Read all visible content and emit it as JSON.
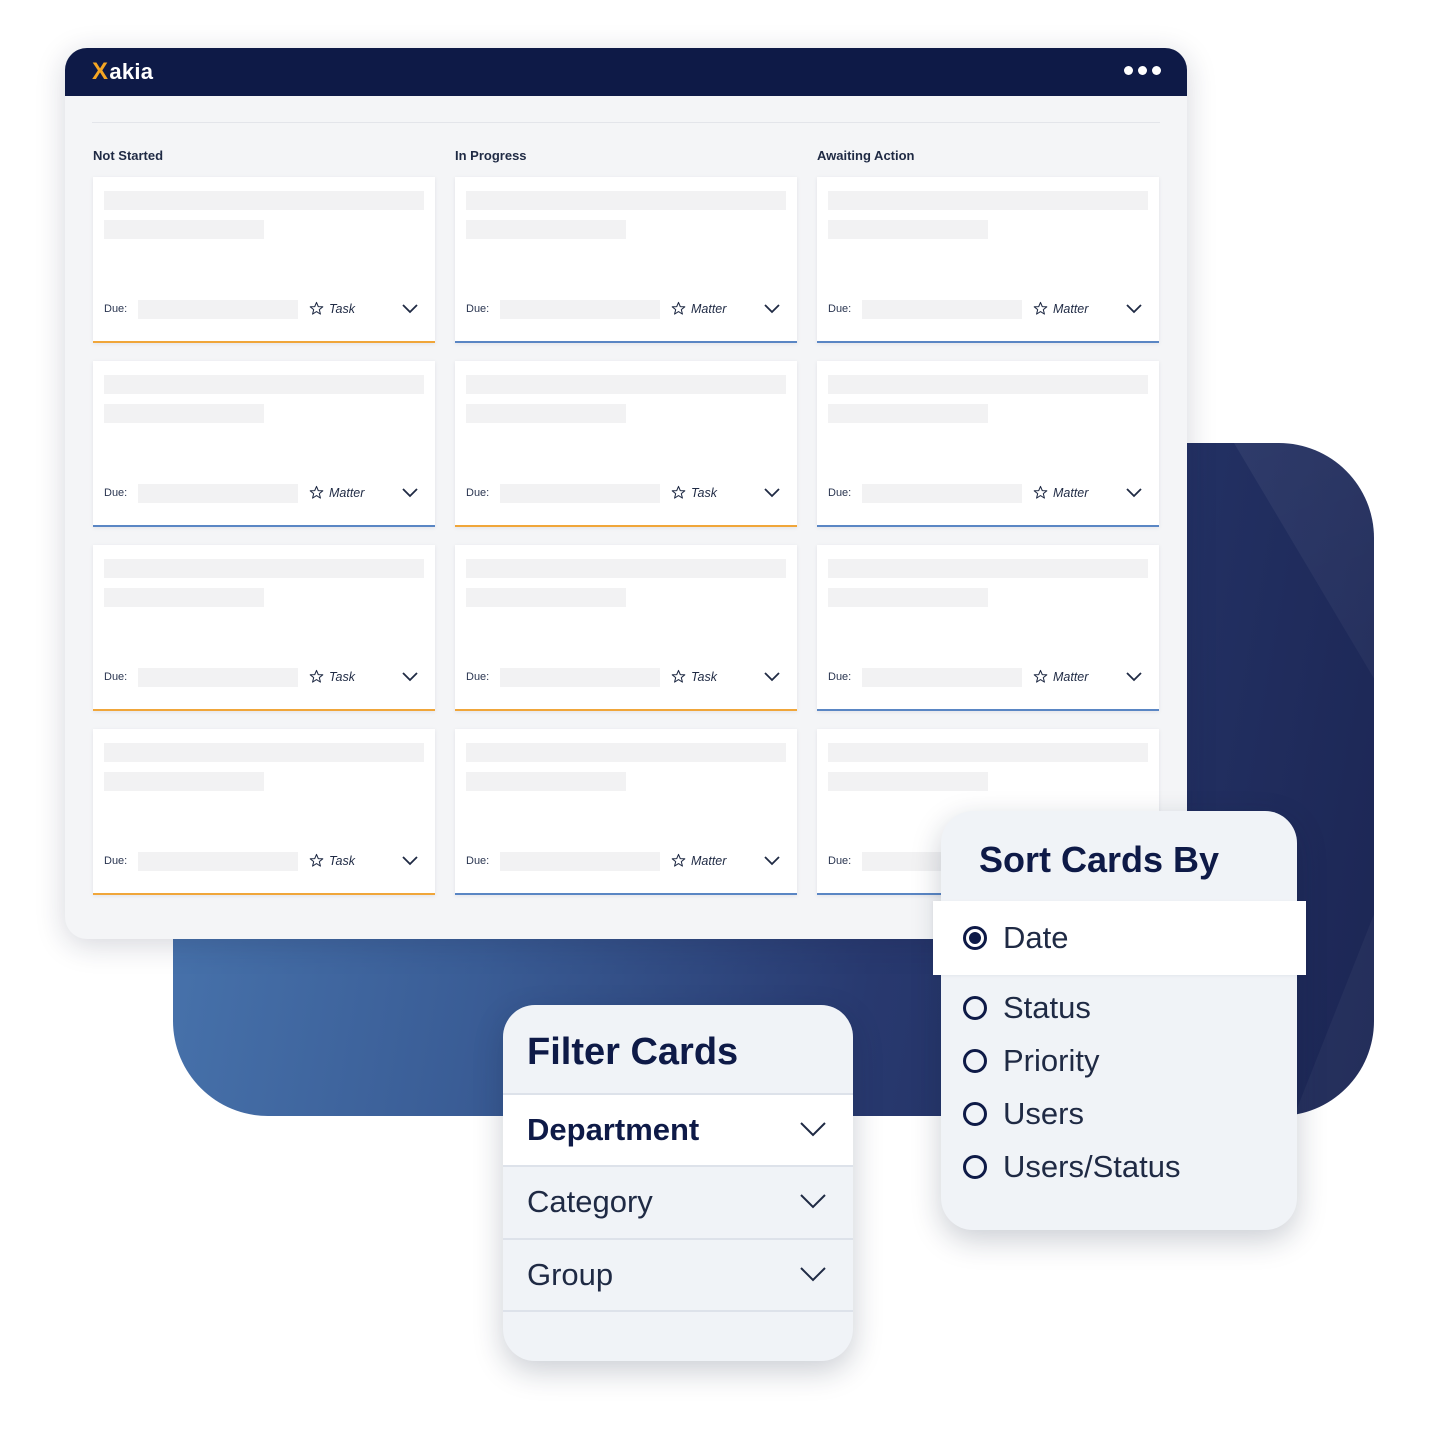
{
  "app": {
    "logo_text": "Xakia",
    "logo_mark": "X",
    "menu_icon": "more-horizontal-icon"
  },
  "columns": [
    {
      "title": "Not Started"
    },
    {
      "title": "In Progress"
    },
    {
      "title": "Awaiting Action"
    }
  ],
  "cards": [
    [
      {
        "due_label": "Due:",
        "type": "Task"
      },
      {
        "due_label": "Due:",
        "type": "Matter"
      },
      {
        "due_label": "Due:",
        "type": "Task"
      },
      {
        "due_label": "Due:",
        "type": "Task"
      }
    ],
    [
      {
        "due_label": "Due:",
        "type": "Matter"
      },
      {
        "due_label": "Due:",
        "type": "Task"
      },
      {
        "due_label": "Due:",
        "type": "Task"
      },
      {
        "due_label": "Due:",
        "type": "Matter"
      }
    ],
    [
      {
        "due_label": "Due:",
        "type": "Matter"
      },
      {
        "due_label": "Due:",
        "type": "Matter"
      },
      {
        "due_label": "Due:",
        "type": "Matter"
      },
      {
        "due_label": "Due:",
        "type": ""
      }
    ]
  ],
  "colors": {
    "header": "#0e1a47",
    "task_accent": "#f0a63a",
    "matter_accent": "#5a86c4"
  },
  "filter_panel": {
    "title": "Filter Cards",
    "rows": [
      {
        "label": "Department"
      },
      {
        "label": "Category"
      },
      {
        "label": "Group"
      }
    ]
  },
  "sort_panel": {
    "title": "Sort Cards By",
    "selected": "Date",
    "options": [
      {
        "label": "Date"
      },
      {
        "label": "Status"
      },
      {
        "label": "Priority"
      },
      {
        "label": "Users"
      },
      {
        "label": "Users/Status"
      }
    ]
  }
}
